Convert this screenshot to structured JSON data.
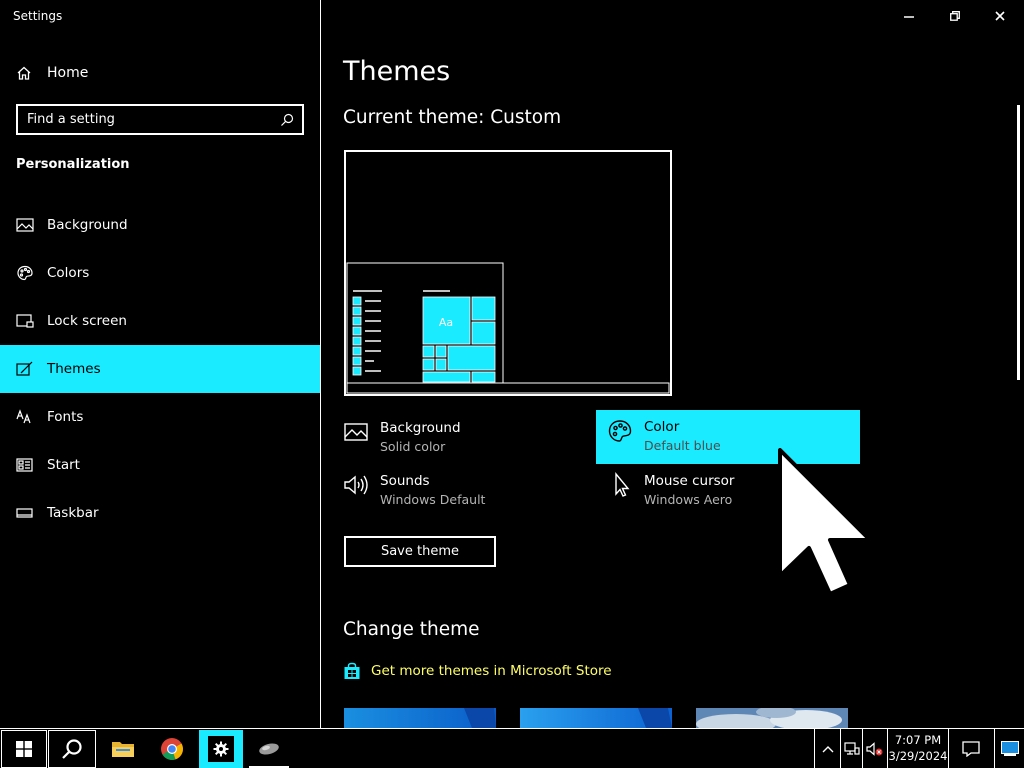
{
  "window": {
    "title": "Settings",
    "minimize": "–",
    "restore": "❐",
    "close": "✕"
  },
  "sidebar": {
    "home_label": "Home",
    "search_placeholder": "Find a setting",
    "section_title": "Personalization",
    "items": [
      {
        "label": "Background",
        "icon": "image-icon"
      },
      {
        "label": "Colors",
        "icon": "palette-icon"
      },
      {
        "label": "Lock screen",
        "icon": "lock-screen-icon"
      },
      {
        "label": "Themes",
        "icon": "brush-icon",
        "active": true
      },
      {
        "label": "Fonts",
        "icon": "font-icon"
      },
      {
        "label": "Start",
        "icon": "start-icon"
      },
      {
        "label": "Taskbar",
        "icon": "taskbar-icon"
      }
    ]
  },
  "main": {
    "page_title": "Themes",
    "current_theme": "Current theme: Custom",
    "preview_sample_text": "Aa",
    "attributes": {
      "background": {
        "title": "Background",
        "value": "Solid color"
      },
      "color": {
        "title": "Color",
        "value": "Default blue"
      },
      "sounds": {
        "title": "Sounds",
        "value": "Windows Default"
      },
      "cursor": {
        "title": "Mouse cursor",
        "value": "Windows Aero"
      }
    },
    "save_button": "Save theme",
    "change_theme_title": "Change theme",
    "store_link": "Get more themes in Microsoft Store"
  },
  "taskbar": {
    "time": "7:07 PM",
    "date": "3/29/2024"
  },
  "colors": {
    "accent": "#1aebff",
    "link": "#ffff66",
    "background": "#000000",
    "foreground": "#ffffff"
  }
}
